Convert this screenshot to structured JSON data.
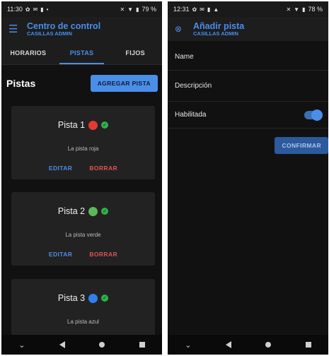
{
  "left": {
    "status": {
      "time": "11:30",
      "battery": "79 %"
    },
    "appbar": {
      "title": "Centro de control",
      "subtitle": "CASILLAS ADMIN"
    },
    "tabs": [
      {
        "label": "HORARIOS"
      },
      {
        "label": "PISTAS"
      },
      {
        "label": "FIJOS"
      }
    ],
    "section_title": "Pistas",
    "add_button": "AGREGAR PISTA",
    "cards": [
      {
        "name": "Pista 1",
        "description": "La pista roja",
        "color": "#e53935",
        "edit": "EDITAR",
        "delete": "BORRAR"
      },
      {
        "name": "Pista 2",
        "description": "La pista verde",
        "color": "#5cb85c",
        "edit": "EDITAR",
        "delete": "BORRAR"
      },
      {
        "name": "Pista 3",
        "description": "La pista azul",
        "color": "#2f80ed"
      }
    ]
  },
  "right": {
    "status": {
      "time": "12:31",
      "battery": "78 %"
    },
    "appbar": {
      "title": "Añadir pista",
      "subtitle": "CASILLAS ADMIN"
    },
    "fields": {
      "name_label": "Name",
      "description_label": "Descripción",
      "enabled_label": "Habilitada"
    },
    "enabled": true,
    "confirm_button": "CONFIRMAR"
  },
  "colors": {
    "accent": "#4a8ee8",
    "danger": "#e05252",
    "background": "#111111"
  }
}
